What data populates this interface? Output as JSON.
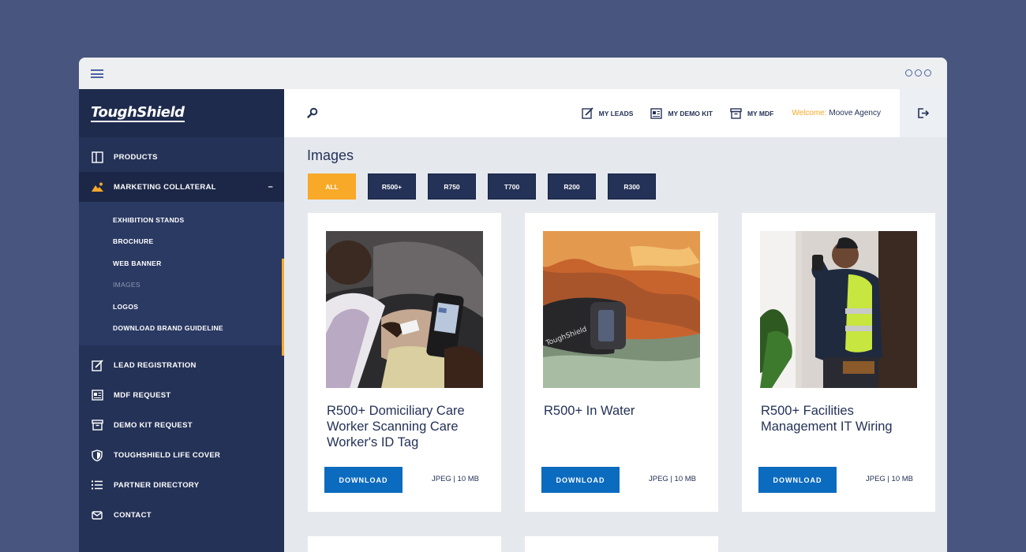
{
  "brand": {
    "logo_text": "ToughShield"
  },
  "sidebar": {
    "items_top": [
      {
        "label": "PRODUCTS",
        "icon": "products-icon"
      },
      {
        "label": "MARKETING COLLATERAL",
        "icon": "image-icon",
        "expanded_symbol": "–"
      }
    ],
    "submenu": [
      {
        "label": "EXHIBITION STANDS"
      },
      {
        "label": "BROCHURE"
      },
      {
        "label": "WEB BANNER"
      },
      {
        "label": "IMAGES"
      },
      {
        "label": "LOGOS"
      },
      {
        "label": "DOWNLOAD BRAND GUIDELINE"
      }
    ],
    "items_bottom": [
      {
        "label": "LEAD REGISTRATION",
        "icon": "edit-icon"
      },
      {
        "label": "MDF REQUEST",
        "icon": "newspaper-icon"
      },
      {
        "label": "DEMO KIT REQUEST",
        "icon": "archive-icon"
      },
      {
        "label": "TOUGHSHIELD LIFE COVER",
        "icon": "shield-icon"
      },
      {
        "label": "PARTNER DIRECTORY",
        "icon": "list-icon"
      },
      {
        "label": "CONTACT",
        "icon": "mail-icon"
      }
    ]
  },
  "topbar": {
    "links": [
      {
        "label": "MY LEADS",
        "icon": "edit-icon"
      },
      {
        "label": "MY DEMO KIT",
        "icon": "newspaper-icon"
      },
      {
        "label": "MY MDF",
        "icon": "archive-icon"
      }
    ],
    "welcome_label": "Welcome:",
    "welcome_user": "Moove Agency"
  },
  "page": {
    "title": "Images",
    "filters": [
      "ALL",
      "R500+",
      "R750",
      "T700",
      "R200",
      "R300"
    ],
    "active_filter": "ALL"
  },
  "cards": [
    {
      "title": "R500+ Domiciliary Care Worker Scanning Care Worker's ID Tag",
      "button": "DOWNLOAD",
      "meta": "JPEG | 10 MB"
    },
    {
      "title": "R500+ In Water",
      "button": "DOWNLOAD",
      "meta": "JPEG | 10 MB"
    },
    {
      "title": "R500+ Facilities Management IT Wiring",
      "button": "DOWNLOAD",
      "meta": "JPEG | 10 MB"
    }
  ],
  "colors": {
    "accent": "#f8a928",
    "navy": "#243257",
    "button_blue": "#0b6bbf",
    "background": "#48557e"
  }
}
